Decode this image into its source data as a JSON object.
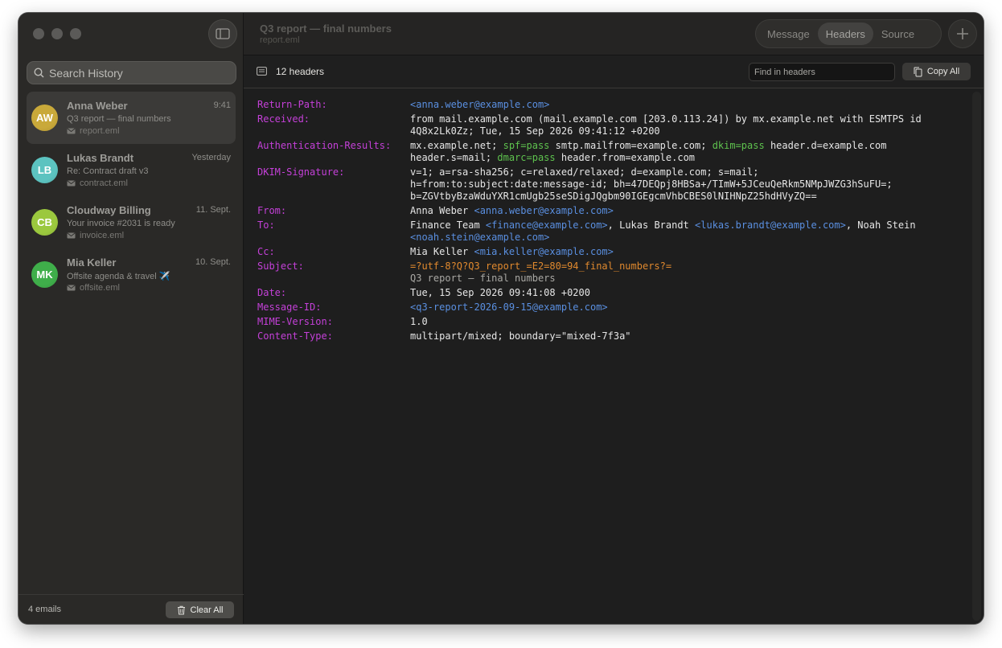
{
  "sidebar": {
    "search_placeholder": "Search History",
    "emails": [
      {
        "initials": "AW",
        "name": "Anna Weber",
        "time": "9:41",
        "subject": "Q3 report — final numbers",
        "file": "report.eml",
        "color": "#c9a93a",
        "selected": true
      },
      {
        "initials": "LB",
        "name": "Lukas Brandt",
        "time": "Yesterday",
        "subject": "Re: Contract draft v3",
        "file": "contract.eml",
        "color": "#5cc3c0"
      },
      {
        "initials": "CB",
        "name": "Cloudway Billing",
        "time": "11. Sept.",
        "subject": "Your invoice #2031 is ready",
        "file": "invoice.eml",
        "color": "#9bc83e"
      },
      {
        "initials": "MK",
        "name": "Mia Keller",
        "time": "10. Sept.",
        "subject": "Offsite agenda & travel ✈️",
        "file": "offsite.eml",
        "color": "#3fae4a"
      }
    ],
    "count": "4 emails",
    "clear_label": "Clear All"
  },
  "titlebar": {
    "title": "Q3 report — final numbers",
    "subtitle": "report.eml",
    "tabs": [
      "Message",
      "Headers",
      "Source"
    ],
    "active_tab": "Headers"
  },
  "toolbar": {
    "header_count": "12 headers",
    "find_placeholder": "Find in headers",
    "copy_label": "Copy All"
  },
  "headers": [
    {
      "name": "Return-Path:",
      "parts": [
        {
          "t": "<anna.weber@example.com>",
          "c": "link"
        }
      ]
    },
    {
      "name": "Received:",
      "parts": [
        {
          "t": "from mail.example.com (mail.example.com [203.0.113.24]) by mx.example.net with ESMTPS id 4Q8x2Lk0Zz; Tue, 15 Sep 2026 09:41:12 +0200"
        }
      ]
    },
    {
      "name": "Authentication-Results:",
      "parts": [
        {
          "t": "mx.example.net; "
        },
        {
          "t": "spf=pass",
          "c": "pass"
        },
        {
          "t": " smtp.mailfrom=example.com; "
        },
        {
          "t": "dkim=pass",
          "c": "pass"
        },
        {
          "t": " header.d=example.com header.s=mail; "
        },
        {
          "t": "dmarc=pass",
          "c": "pass"
        },
        {
          "t": " header.from=example.com"
        }
      ]
    },
    {
      "name": "DKIM-Signature:",
      "parts": [
        {
          "t": "v=1; a=rsa-sha256; c=relaxed/relaxed; d=example.com; s=mail;\nh=from:to:subject:date:message-id; bh=47DEQpj8HBSa+/TImW+5JCeuQeRkm5NMpJWZG3hSuFU=;\nb=ZGVtbyBzaWduYXR1cmUgb25seSDigJQgbm90IGEgcmVhbCBES0lNIHNpZ25hdHVyZQ=="
        }
      ]
    },
    {
      "name": "From:",
      "parts": [
        {
          "t": "Anna Weber "
        },
        {
          "t": "<anna.weber@example.com>",
          "c": "link"
        }
      ]
    },
    {
      "name": "To:",
      "parts": [
        {
          "t": "Finance Team "
        },
        {
          "t": "<finance@example.com>",
          "c": "link"
        },
        {
          "t": ", Lukas Brandt "
        },
        {
          "t": "<lukas.brandt@example.com>",
          "c": "link"
        },
        {
          "t": ", Noah Stein "
        },
        {
          "t": "<noah.stein@example.com>",
          "c": "link"
        }
      ]
    },
    {
      "name": "Cc:",
      "parts": [
        {
          "t": "Mia Keller "
        },
        {
          "t": "<mia.keller@example.com>",
          "c": "link"
        }
      ]
    },
    {
      "name": "Subject:",
      "parts": [
        {
          "t": "=?utf-8?Q?Q3_report_=E2=80=94_final_numbers?=",
          "c": "enc"
        },
        {
          "t": "\nQ3 report — final numbers",
          "c": "decoded"
        }
      ]
    },
    {
      "name": "Date:",
      "parts": [
        {
          "t": "Tue, 15 Sep 2026 09:41:08 +0200"
        }
      ]
    },
    {
      "name": "Message-ID:",
      "parts": [
        {
          "t": "<q3-report-2026-09-15@example.com>",
          "c": "link"
        }
      ]
    },
    {
      "name": "MIME-Version:",
      "parts": [
        {
          "t": "1.0"
        }
      ]
    },
    {
      "name": "Content-Type:",
      "parts": [
        {
          "t": "multipart/mixed; boundary=\"mixed-7f3a\""
        }
      ]
    }
  ]
}
